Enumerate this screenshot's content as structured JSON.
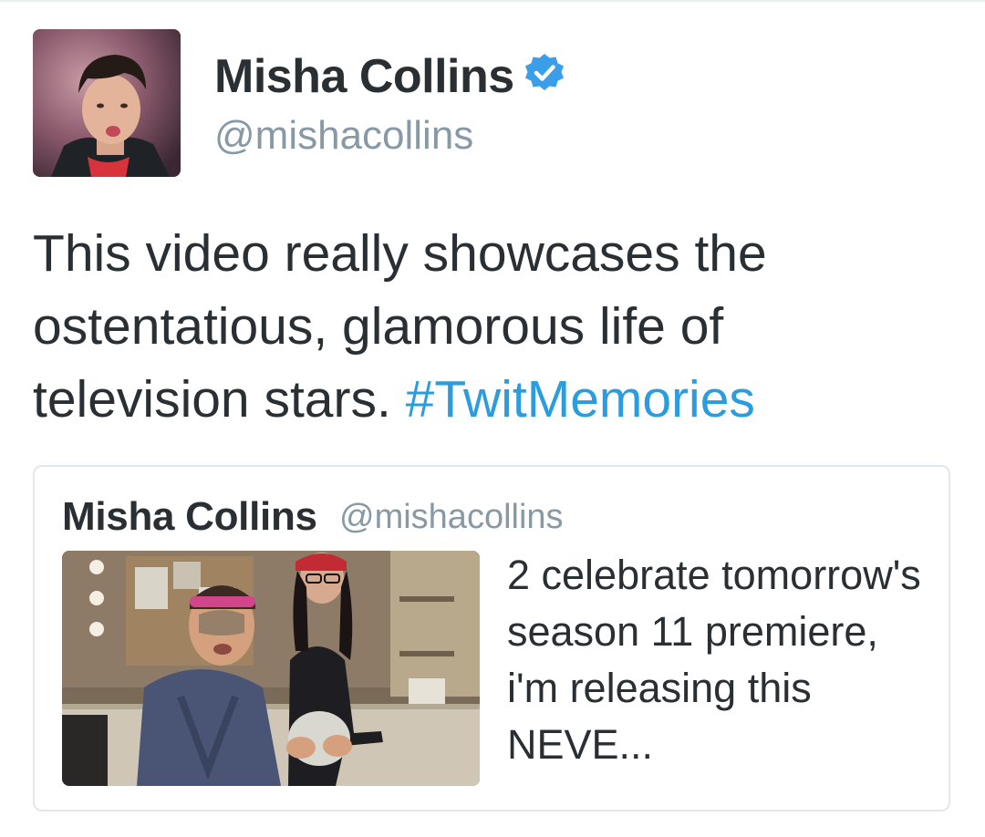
{
  "tweet": {
    "author": {
      "name": "Misha Collins",
      "handle": "@mishacollins",
      "verified": true
    },
    "text": "This video really showcases the ostentatious, glamorous life of television stars.",
    "hashtag": "#TwitMemories"
  },
  "quoted_tweet": {
    "author": {
      "name": "Misha Collins",
      "handle": "@mishacollins"
    },
    "text": "2 celebrate tomorrow's season 11 premiere, i'm releasing this NEVE..."
  },
  "colors": {
    "text": "#292f33",
    "muted": "#8899a6",
    "link": "#2b9cdd",
    "verified": "#3a9ee8",
    "border": "#e1e8ed"
  },
  "icons": {
    "verified": "verified-badge-icon"
  }
}
